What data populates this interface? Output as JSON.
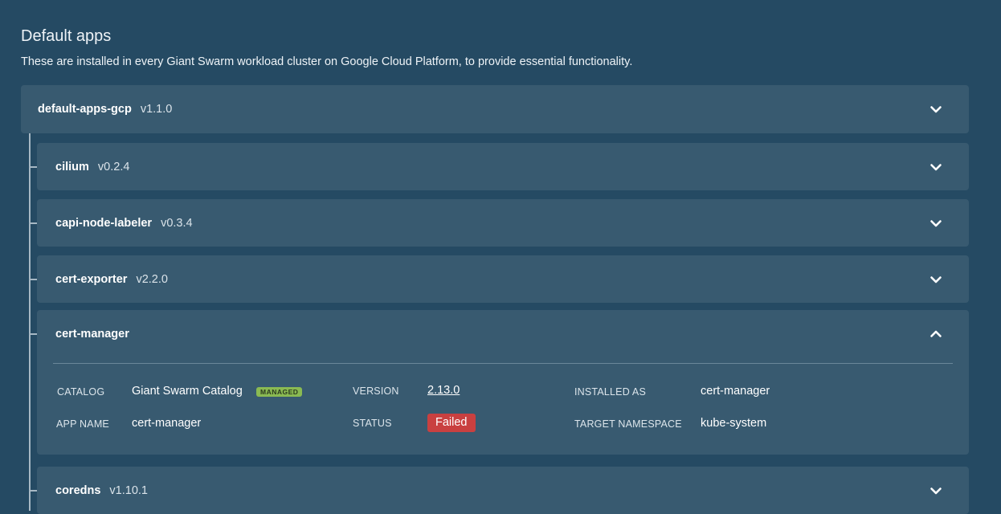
{
  "section": {
    "title": "Default apps",
    "description": "These are installed in every Giant Swarm workload cluster on Google Cloud Platform, to provide essential functionality."
  },
  "bundle": {
    "name": "default-apps-gcp",
    "version": "v1.1.0",
    "expanded": false
  },
  "apps": [
    {
      "name": "cilium",
      "version": "v0.2.4",
      "expanded": false
    },
    {
      "name": "capi-node-labeler",
      "version": "v0.3.4",
      "expanded": false
    },
    {
      "name": "cert-exporter",
      "version": "v2.2.0",
      "expanded": false
    },
    {
      "name": "cert-manager",
      "version": "",
      "expanded": true,
      "details": {
        "catalog_label": "CATALOG",
        "catalog_value": "Giant Swarm Catalog",
        "managed_badge": "MANAGED",
        "version_label": "VERSION",
        "version_value": "2.13.0",
        "installed_as_label": "INSTALLED AS",
        "installed_as_value": "cert-manager",
        "app_name_label": "APP NAME",
        "app_name_value": "cert-manager",
        "status_label": "STATUS",
        "status_value": "Failed",
        "target_namespace_label": "TARGET NAMESPACE",
        "target_namespace_value": "kube-system"
      }
    },
    {
      "name": "coredns",
      "version": "v1.10.1",
      "expanded": false
    }
  ],
  "icons": {
    "collapsed": "chevron-down-icon",
    "expanded": "chevron-up-icon"
  },
  "colors": {
    "background": "#254a63",
    "card": "#385a70",
    "managed_badge": "#8aba52",
    "status_failed": "#c94040",
    "tree_line": "#a7b8c4"
  }
}
